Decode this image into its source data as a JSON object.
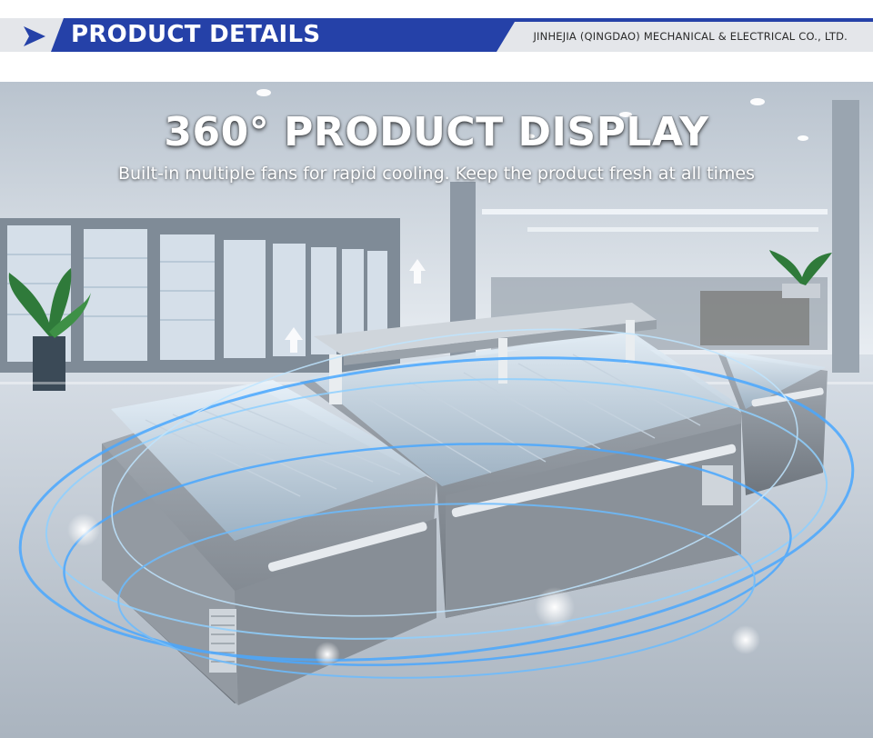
{
  "header": {
    "title": "PRODUCT DETAILS",
    "company": "JINHEJIA (QINGDAO) MECHANICAL & ELECTRICAL CO., LTD.",
    "icon": "chevron-arrow-icon",
    "colors": {
      "banner_blue": "#2541a8",
      "banner_gray": "#e4e6ea"
    }
  },
  "hero": {
    "title": "360° PRODUCT DISPLAY",
    "subtitle": "Built-in multiple fans for rapid cooling. Keep the product fresh at all times",
    "image": "island-freezer-supermarket-photo",
    "colors": {
      "glow_blue": "#4aa8ff"
    }
  }
}
